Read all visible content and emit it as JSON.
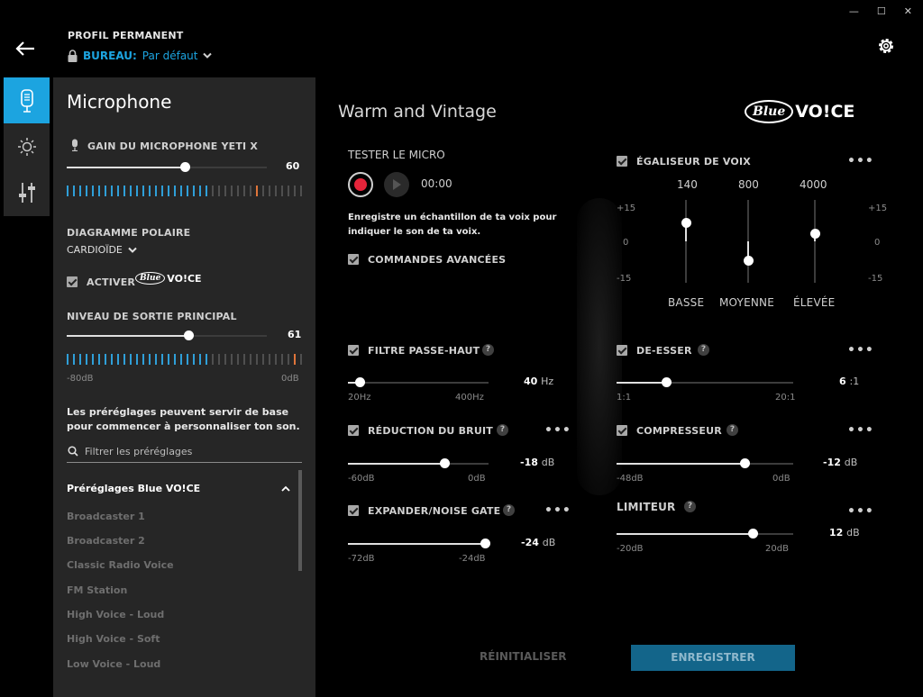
{
  "window": {
    "minimize": "—",
    "maximize": "☐",
    "close": "✕"
  },
  "header": {
    "profile_label": "PROFIL PERMANENT",
    "profile_name": "BUREAU:",
    "profile_value": "Par défaut"
  },
  "panel": {
    "title": "Microphone",
    "gain_label": "GAIN DU MICROPHONE YETI X",
    "gain_value": "60",
    "polar_label": "DIAGRAMME POLAIRE",
    "polar_value": "CARDIOÏDE",
    "activate_label": "ACTIVER",
    "output_label": "NIVEAU DE SORTIE PRINCIPAL",
    "output_value": "61",
    "output_min": "-80dB",
    "output_max": "0dB",
    "presets_desc": "Les préréglages peuvent servir de base pour commencer à personnaliser ton son.",
    "filter_placeholder": "Filtrer les préréglages",
    "presets_header": "Préréglages Blue VO!CE",
    "presets": [
      "Broadcaster 1",
      "Broadcaster 2",
      "Classic Radio Voice",
      "FM Station",
      "High Voice - Loud",
      "High Voice - Soft",
      "Low Voice - Loud"
    ]
  },
  "logo": {
    "blue": "Blue",
    "voice": "VO!CE"
  },
  "main": {
    "preset_title": "Warm and Vintage",
    "test_label": "TESTER LE MICRO",
    "timer": "00:00",
    "record_desc": "Enregistre un échantillon de ta voix pour indiquer le son de ta voix.",
    "advanced_label": "COMMANDES AVANCÉES",
    "highpass": {
      "label": "FILTRE PASSE-HAUT",
      "value": "40",
      "unit": "Hz",
      "min": "20Hz",
      "max": "400Hz"
    },
    "noise": {
      "label": "RÉDUCTION DU BRUIT",
      "value": "-18",
      "unit": "dB",
      "min": "-60dB",
      "max": "0dB"
    },
    "expander": {
      "label": "EXPANDER/NOISE GATE",
      "value": "-24",
      "unit": "dB",
      "min": "-72dB",
      "max": "-24dB"
    },
    "eq": {
      "label": "ÉGALISEUR DE VOIX",
      "freqs": [
        "140",
        "800",
        "4000"
      ],
      "bands": [
        "BASSE",
        "MOYENNE",
        "ÉLEVÉE"
      ],
      "scale_top": "+15",
      "scale_mid": "0",
      "scale_bottom": "-15"
    },
    "deesser": {
      "label": "DE-ESSER",
      "value": "6",
      "unit": ":1",
      "min": "1:1",
      "max": "20:1"
    },
    "compressor": {
      "label": "COMPRESSEUR",
      "value": "-12",
      "unit": "dB",
      "min": "-48dB",
      "max": "0dB"
    },
    "limiter": {
      "label": "LIMITEUR",
      "value": "12",
      "unit": "dB",
      "min": "-20dB",
      "max": "20dB"
    },
    "more": "•••",
    "help": "?"
  },
  "footer": {
    "reset": "RÉINITIALISER",
    "save": "ENREGISTRER"
  },
  "colors": {
    "accent": "#1ca4e0",
    "save_button": "#13658a",
    "record": "#e5243a"
  }
}
